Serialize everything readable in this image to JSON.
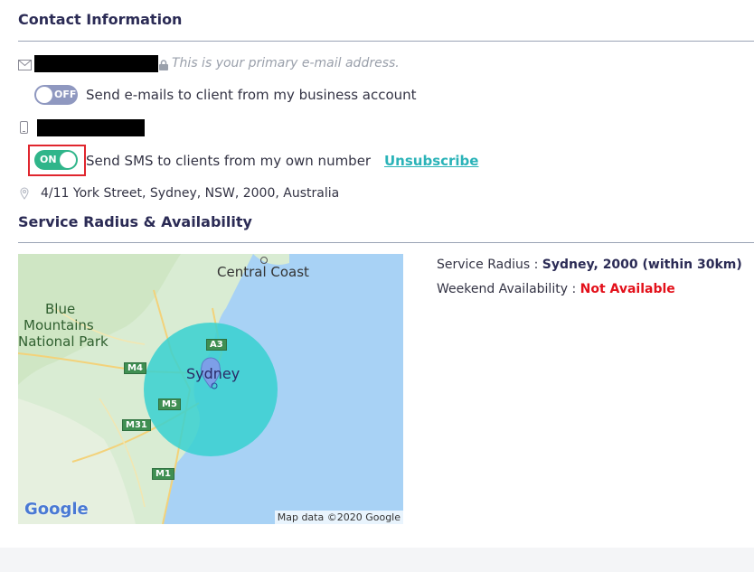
{
  "contact": {
    "title": "Contact Information",
    "email_hint": "This is your primary e-mail address.",
    "email_toggle": {
      "state": "OFF",
      "label": "Send e-mails to client from my business account"
    },
    "sms_toggle": {
      "state": "ON",
      "label": "Send SMS to clients from my own number"
    },
    "unsubscribe": "Unsubscribe",
    "address": "4/11 York Street, Sydney, NSW, 2000, Australia"
  },
  "service": {
    "title": "Service Radius & Availability",
    "radius_label": "Service Radius : ",
    "radius_value": "Sydney, 2000 (within 30km)",
    "weekend_label": "Weekend Availability : ",
    "weekend_value": "Not Available"
  },
  "map": {
    "labels": {
      "central_coast": "Central Coast",
      "blue_mountains_1": "Blue",
      "blue_mountains_2": "Mountains",
      "blue_mountains_3": "National Park",
      "sydney": "Sydney"
    },
    "roads": {
      "a3": "A3",
      "m4": "M4",
      "m5": "M5",
      "m31": "M31",
      "m1": "M1"
    },
    "logo": "Google",
    "attribution": "Map data ©2020 Google",
    "colors": {
      "land": "#d9ecd3",
      "water": "#a8d2f5",
      "radius": "#37d1d0",
      "marker": "#7d9fe8"
    }
  }
}
